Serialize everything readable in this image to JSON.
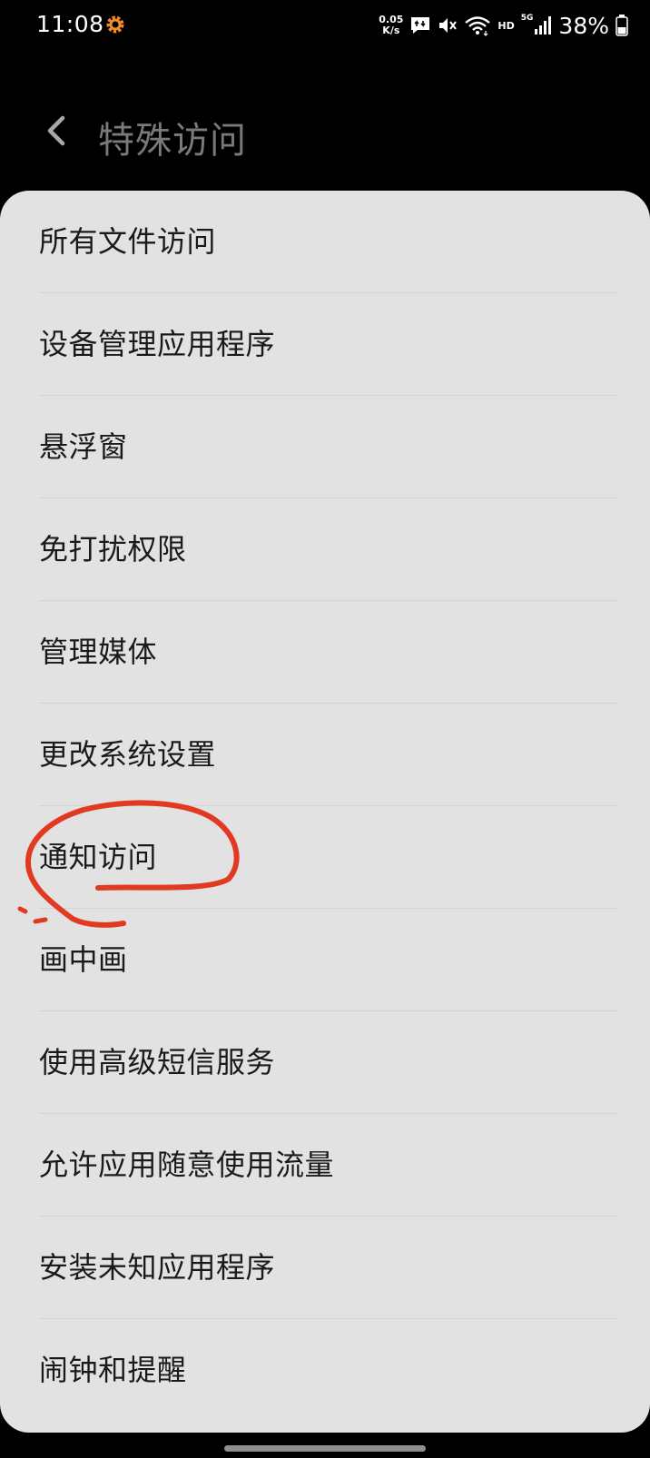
{
  "status_bar": {
    "time": "11:08",
    "net_speed_value": "0.05",
    "net_speed_unit": "K/s",
    "hd_label": "HD",
    "network_type": "5G",
    "battery": "38%"
  },
  "header": {
    "title": "特殊访问"
  },
  "items": [
    {
      "label": "所有文件访问"
    },
    {
      "label": "设备管理应用程序"
    },
    {
      "label": "悬浮窗"
    },
    {
      "label": "免打扰权限"
    },
    {
      "label": "管理媒体"
    },
    {
      "label": "更改系统设置"
    },
    {
      "label": "通知访问"
    },
    {
      "label": "画中画"
    },
    {
      "label": "使用高级短信服务"
    },
    {
      "label": "允许应用随意使用流量"
    },
    {
      "label": "安装未知应用程序"
    },
    {
      "label": "闹钟和提醒"
    }
  ],
  "colors": {
    "background": "#000000",
    "card": "#e2e2e2",
    "annotation": "#e23a22",
    "gear_icon": "#f08a2a"
  }
}
